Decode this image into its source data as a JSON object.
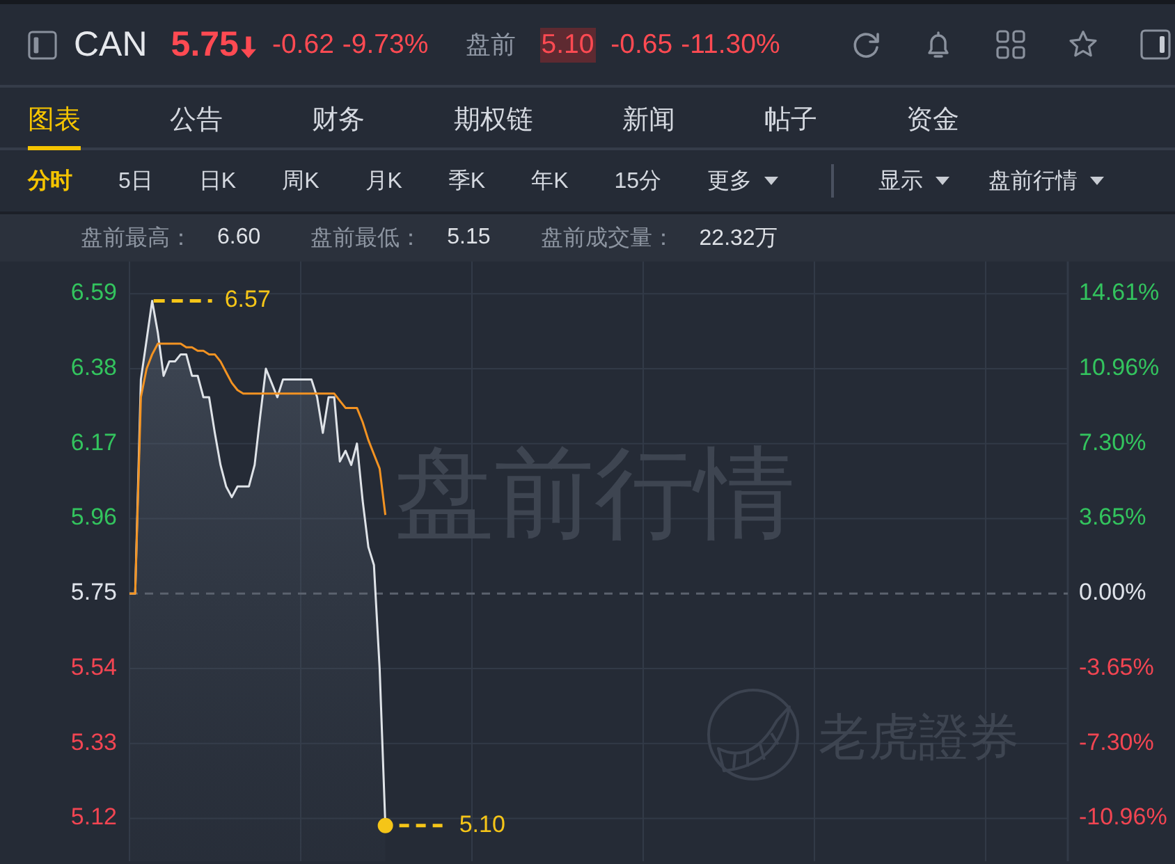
{
  "header": {
    "ticker": "CAN",
    "price": "5.75",
    "down": true,
    "change": "-0.62",
    "percent": "-9.73%",
    "premarket": {
      "label": "盘前",
      "price": "5.10",
      "down": true,
      "flash": true,
      "change": "-0.65",
      "percent": "-11.30%"
    }
  },
  "tabs": [
    {
      "label": "图表",
      "selected": true
    },
    {
      "label": "公告",
      "selected": false
    },
    {
      "label": "财务",
      "selected": false
    },
    {
      "label": "期权链",
      "selected": false
    },
    {
      "label": "新闻",
      "selected": false
    },
    {
      "label": "帖子",
      "selected": false
    },
    {
      "label": "资金",
      "selected": false
    }
  ],
  "chart_toolbar": {
    "periods": [
      {
        "label": "分时",
        "selected": true,
        "kind": "period"
      },
      {
        "label": "5日",
        "selected": false,
        "kind": "period"
      },
      {
        "label": "日K",
        "selected": false,
        "kind": "period"
      },
      {
        "label": "周K",
        "selected": false,
        "kind": "period"
      },
      {
        "label": "月K",
        "selected": false,
        "kind": "period"
      },
      {
        "label": "季K",
        "selected": false,
        "kind": "period"
      },
      {
        "label": "年K",
        "selected": false,
        "kind": "period"
      },
      {
        "label": "15分",
        "selected": false,
        "kind": "period"
      },
      {
        "label": "更多",
        "selected": false,
        "kind": "dropdown"
      }
    ],
    "menus": [
      {
        "label": "显示"
      },
      {
        "label": "盘前行情"
      }
    ]
  },
  "stats": [
    {
      "label": "盘前最高：",
      "value": "6.60"
    },
    {
      "label": "盘前最低：",
      "value": "5.15"
    },
    {
      "label": "盘前成交量：",
      "value": "22.32万"
    }
  ],
  "chart": {
    "watermark": "盘前行情",
    "brand": "老虎證券",
    "high_label": "6.57",
    "last_label": "5.10",
    "percent_ticks": [
      "14.61%",
      "10.96%",
      "7.30%",
      "3.65%",
      "0.00%",
      "-3.65%",
      "-7.30%",
      "-10.96%"
    ],
    "chart_data": {
      "type": "area",
      "grid": true,
      "categories": [
        null,
        null,
        null,
        null,
        null,
        null,
        null,
        null,
        null,
        null,
        null,
        null,
        null,
        null,
        null,
        null,
        null,
        null,
        null,
        null,
        null,
        null,
        null,
        null,
        null,
        null,
        null,
        null,
        null,
        null,
        null,
        null,
        null,
        null,
        null,
        null,
        null,
        null,
        null,
        null,
        null,
        null,
        null,
        null,
        null,
        null,
        null,
        null,
        null,
        null,
        null,
        null,
        null,
        null,
        null,
        null,
        null,
        null,
        null,
        null,
        null,
        null,
        null,
        null,
        null,
        null,
        null,
        null,
        null,
        null,
        null,
        null,
        null,
        null,
        null,
        null,
        null,
        null,
        null,
        null,
        null,
        null,
        null,
        null,
        null,
        null,
        null,
        null,
        null,
        null,
        null,
        null,
        null,
        null,
        null,
        null,
        null,
        null,
        null,
        null,
        null,
        null,
        null,
        null,
        null,
        null,
        null,
        null,
        null,
        null,
        null,
        null,
        null,
        null,
        null,
        null,
        null,
        null,
        null,
        null,
        null,
        null,
        null,
        null,
        null,
        null,
        null,
        null,
        null,
        null,
        null,
        null,
        null,
        null,
        null,
        null,
        null,
        null,
        null,
        null,
        null,
        null,
        null,
        null,
        null,
        null,
        null,
        null,
        null,
        null,
        null,
        null,
        null,
        null,
        null,
        null,
        null,
        null,
        null,
        null,
        null,
        null,
        null,
        null,
        null,
        null
      ],
      "series": [
        {
          "color": "#dfe3e8",
          "values": [
            5.75,
            5.75,
            6.35,
            6.46,
            6.57,
            6.48,
            6.36,
            6.4,
            6.4,
            6.42,
            6.42,
            6.36,
            6.36,
            6.3,
            6.3,
            6.2,
            6.11,
            6.05,
            6.02,
            6.05,
            6.05,
            6.05,
            6.11,
            6.25,
            6.38,
            6.34,
            6.3,
            6.35,
            6.35,
            6.35,
            6.35,
            6.35,
            6.35,
            6.3,
            6.2,
            6.3,
            6.3,
            6.12,
            6.15,
            6.11,
            6.17,
            6.01,
            5.88,
            5.83,
            5.54,
            5.1,
            null,
            null,
            null,
            null,
            null,
            null,
            null,
            null,
            null,
            null,
            null,
            null,
            null,
            null,
            null,
            null,
            null,
            null,
            null,
            null,
            null,
            null,
            null,
            null,
            null,
            null,
            null,
            null,
            null,
            null,
            null,
            null,
            null,
            null,
            null,
            null,
            null,
            null,
            null,
            null,
            null,
            null,
            null,
            null,
            null,
            null,
            null,
            null,
            null,
            null,
            null,
            null,
            null,
            null,
            null,
            null,
            null,
            null,
            null,
            null,
            null,
            null,
            null,
            null,
            null,
            null,
            null,
            null,
            null,
            null,
            null,
            null,
            null,
            null,
            null,
            null,
            null,
            null,
            null,
            null,
            null,
            null,
            null,
            null,
            null,
            null,
            null,
            null,
            null,
            null,
            null,
            null,
            null,
            null,
            null,
            null,
            null,
            null,
            null,
            null,
            null,
            null,
            null,
            null,
            null,
            null,
            null,
            null,
            null,
            null,
            null,
            null,
            null,
            null,
            null,
            null,
            null,
            null,
            null,
            null
          ]
        },
        {
          "type": "line",
          "color": "#f39322",
          "values": [
            5.75,
            5.75,
            6.3,
            6.38,
            6.42,
            6.45,
            6.45,
            6.45,
            6.45,
            6.45,
            6.44,
            6.44,
            6.43,
            6.43,
            6.42,
            6.42,
            6.4,
            6.37,
            6.34,
            6.32,
            6.31,
            6.31,
            6.31,
            6.31,
            6.31,
            6.31,
            6.31,
            6.31,
            6.31,
            6.31,
            6.31,
            6.31,
            6.31,
            6.31,
            6.31,
            6.31,
            6.31,
            6.29,
            6.27,
            6.27,
            6.27,
            6.23,
            6.18,
            6.14,
            6.1,
            5.97,
            null,
            null,
            null,
            null,
            null,
            null,
            null,
            null,
            null,
            null,
            null,
            null,
            null,
            null,
            null,
            null,
            null,
            null,
            null,
            null,
            null,
            null,
            null,
            null,
            null,
            null,
            null,
            null,
            null,
            null,
            null,
            null,
            null,
            null,
            null,
            null,
            null,
            null,
            null,
            null,
            null,
            null,
            null,
            null,
            null,
            null,
            null,
            null,
            null,
            null,
            null,
            null,
            null,
            null,
            null,
            null,
            null,
            null,
            null,
            null,
            null,
            null,
            null,
            null,
            null,
            null,
            null,
            null,
            null,
            null,
            null,
            null,
            null,
            null,
            null,
            null,
            null,
            null,
            null,
            null,
            null,
            null,
            null,
            null,
            null,
            null,
            null,
            null,
            null,
            null,
            null,
            null,
            null,
            null,
            null,
            null,
            null,
            null,
            null,
            null,
            null,
            null,
            null,
            null,
            null,
            null,
            null,
            null,
            null,
            null,
            null,
            null,
            null,
            null,
            null,
            null,
            null,
            null,
            null,
            null
          ]
        }
      ],
      "ylim": [
        5.0,
        6.68
      ],
      "yticks": [
        {
          "value": 6.59,
          "label": "6.59"
        },
        {
          "value": 6.38,
          "label": "6.38"
        },
        {
          "value": 6.17,
          "label": "6.17"
        },
        {
          "value": 5.96,
          "label": "5.96"
        },
        {
          "value": 5.75,
          "label": "5.75"
        },
        {
          "value": 5.54,
          "label": "5.54"
        },
        {
          "value": 5.33,
          "label": "5.33"
        },
        {
          "value": 5.12,
          "label": "5.12"
        }
      ],
      "ref_lines": [
        {
          "axis": "y",
          "value": 5.75
        }
      ]
    }
  }
}
